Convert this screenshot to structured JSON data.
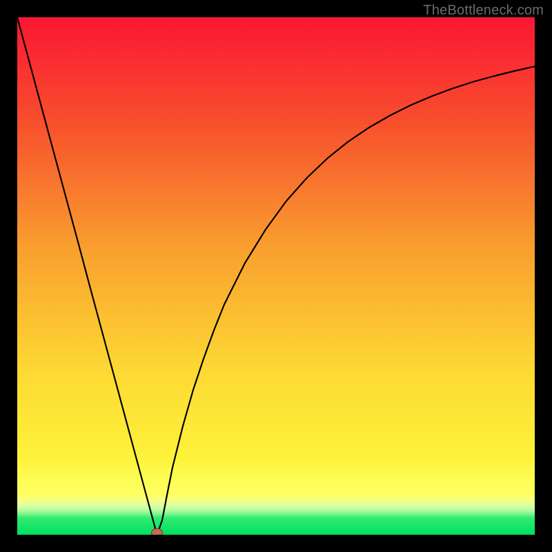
{
  "watermark": "TheBottleneck.com",
  "colors": {
    "frame": "#000000",
    "curve": "#000000",
    "marker_fill": "#c76a52",
    "marker_stroke": "#7a2f1e",
    "gradient_top": "#fb1633",
    "gradient_mid_upper": "#f97c2d",
    "gradient_mid": "#fde337",
    "gradient_low_yellow": "#ffff66",
    "gradient_pale": "#e9ffb0",
    "gradient_bottom": "#00e060"
  },
  "chart_data": {
    "type": "line",
    "title": "",
    "xlabel": "",
    "ylabel": "",
    "xlim": [
      0,
      100
    ],
    "ylim": [
      0,
      100
    ],
    "x": [
      0,
      2,
      4,
      6,
      8,
      10,
      12,
      14,
      16,
      18,
      20,
      22,
      24,
      26,
      27,
      28,
      29,
      30,
      32,
      34,
      36,
      38,
      40,
      44,
      48,
      52,
      56,
      60,
      64,
      68,
      72,
      76,
      80,
      84,
      88,
      92,
      96,
      100
    ],
    "series": [
      {
        "name": "bottleneck-curve",
        "values": [
          100,
          92.6,
          85.2,
          77.8,
          70.4,
          63.0,
          55.6,
          48.1,
          40.7,
          33.3,
          25.9,
          18.5,
          11.1,
          3.7,
          0,
          2.8,
          8.0,
          13.0,
          21.0,
          28.0,
          34.0,
          39.5,
          44.5,
          52.5,
          59.0,
          64.5,
          69.0,
          72.8,
          76.0,
          78.7,
          81.0,
          83.0,
          84.7,
          86.2,
          87.5,
          88.6,
          89.6,
          90.5
        ]
      }
    ],
    "marker": {
      "x": 27,
      "y": 0
    },
    "gradient_bands": [
      {
        "y_from": 100,
        "y_to": 10,
        "type": "smooth",
        "top_color": "#fb1633",
        "bottom_color": "#ffff40"
      },
      {
        "y_from": 10,
        "y_to": 6.8,
        "color": "#ffff66"
      },
      {
        "y_from": 6.8,
        "y_to": 5.2,
        "type": "smooth",
        "top_color": "#f2ff90",
        "bottom_color": "#c8ffb0"
      },
      {
        "y_from": 5.2,
        "y_to": 3.8,
        "type": "smooth",
        "top_color": "#a8f8a0",
        "bottom_color": "#60ef80"
      },
      {
        "y_from": 3.8,
        "y_to": 0,
        "color": "#00e060"
      }
    ]
  }
}
